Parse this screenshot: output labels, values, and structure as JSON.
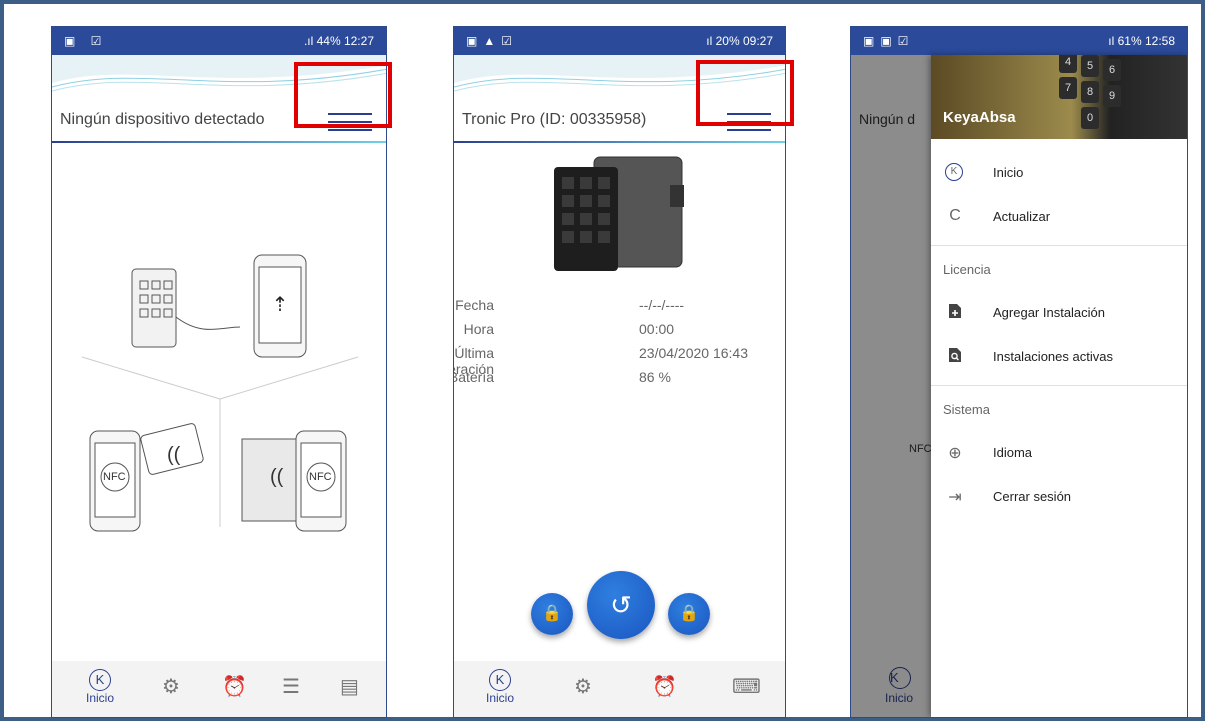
{
  "phone1": {
    "status_right": ".ıl 44% 12:27",
    "title": "Ningún dispositivo detectado",
    "nfc_label": "NFC",
    "nfc_label_2": "NFC",
    "tabs": [
      {
        "label": "Inicio"
      }
    ]
  },
  "phone2": {
    "status_right": "ıl 20% 09:27",
    "title": "Tronic Pro (ID: 00335958)",
    "info": [
      {
        "key": "Fecha",
        "value": "--/--/----"
      },
      {
        "key": "Hora",
        "value": "00:00"
      },
      {
        "key": "Última Operación",
        "value": "23/04/2020 16:43"
      },
      {
        "key": "Batería",
        "value": "86 %"
      }
    ],
    "tabs": [
      {
        "label": "Inicio"
      }
    ]
  },
  "phone3": {
    "status_right": "ıl 61% 12:58",
    "title_partial": "Ningún d",
    "nfc_label": "NFC",
    "brand": "KeyaAbsa",
    "keys": [
      "4",
      "5",
      "6",
      "7",
      "8",
      "9",
      "0"
    ],
    "items": [
      {
        "label": "Inicio"
      },
      {
        "label": "Actualizar"
      }
    ],
    "section_license": "Licencia",
    "license_items": [
      {
        "label": "Agregar Instalación"
      },
      {
        "label": "Instalaciones activas"
      }
    ],
    "section_system": "Sistema",
    "system_items": [
      {
        "label": "Idioma"
      },
      {
        "label": "Cerrar sesión"
      }
    ],
    "tab_label": "Inicio"
  },
  "icons": {
    "k_logo": "K",
    "gear": "⚙",
    "alarm": "⏰",
    "list": "☰",
    "card": "▤",
    "keypad": "⌨",
    "refresh": "C",
    "globe": "⊕",
    "logout": "⇥",
    "lock": "🔒",
    "history": "↺"
  },
  "colors": {
    "accent": "#2b3f8f",
    "highlight": "#e00000",
    "button": "#1f63cf"
  }
}
